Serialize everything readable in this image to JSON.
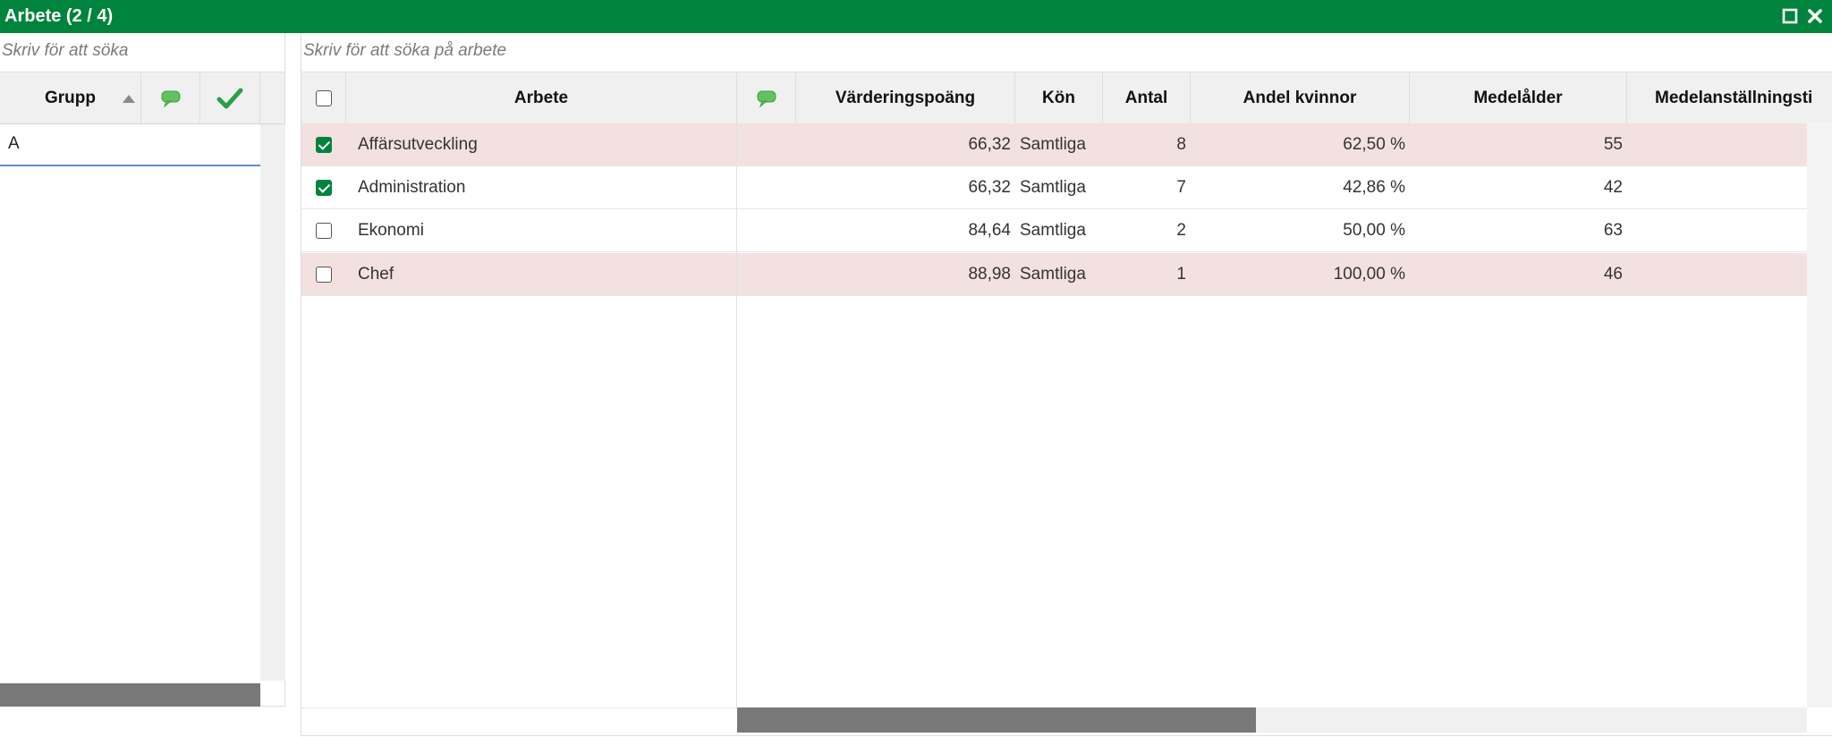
{
  "window": {
    "title": "Arbete (2 / 4)",
    "maximize_icon": "maximize-icon",
    "close_icon": "close-icon"
  },
  "colors": {
    "titlebar": "#00843d",
    "row_highlight": "#f3e1e0",
    "check": "#00843d",
    "comment_icon": "#62c262"
  },
  "left": {
    "search_placeholder": "Skriv för att söka",
    "columns": {
      "group": "Grupp",
      "sort_icon": "sort-ascending-icon",
      "comment_icon": "comment-icon",
      "check_icon": "checkmark-icon"
    },
    "rows": [
      {
        "label": "A"
      }
    ]
  },
  "right": {
    "search_placeholder": "Skriv för att söka på arbete",
    "columns": {
      "work": "Arbete",
      "comment_icon": "comment-icon",
      "score": "Värderingspoäng",
      "gender": "Kön",
      "count": "Antal",
      "share_women": "Andel kvinnor",
      "avg_age": "Medelålder",
      "avg_tenure": "Medelanställningsti"
    },
    "rows": [
      {
        "checked": true,
        "highlight": true,
        "work": "Affärsutveckling",
        "score": "66,32",
        "gender": "Samtliga",
        "count": "8",
        "share_women": "62,50 %",
        "avg_age": "55"
      },
      {
        "checked": true,
        "highlight": false,
        "work": "Administration",
        "score": "66,32",
        "gender": "Samtliga",
        "count": "7",
        "share_women": "42,86 %",
        "avg_age": "42"
      },
      {
        "checked": false,
        "highlight": false,
        "work": "Ekonomi",
        "score": "84,64",
        "gender": "Samtliga",
        "count": "2",
        "share_women": "50,00 %",
        "avg_age": "63"
      },
      {
        "checked": false,
        "highlight": true,
        "work": "Chef",
        "score": "88,98",
        "gender": "Samtliga",
        "count": "1",
        "share_women": "100,00 %",
        "avg_age": "46"
      }
    ]
  }
}
